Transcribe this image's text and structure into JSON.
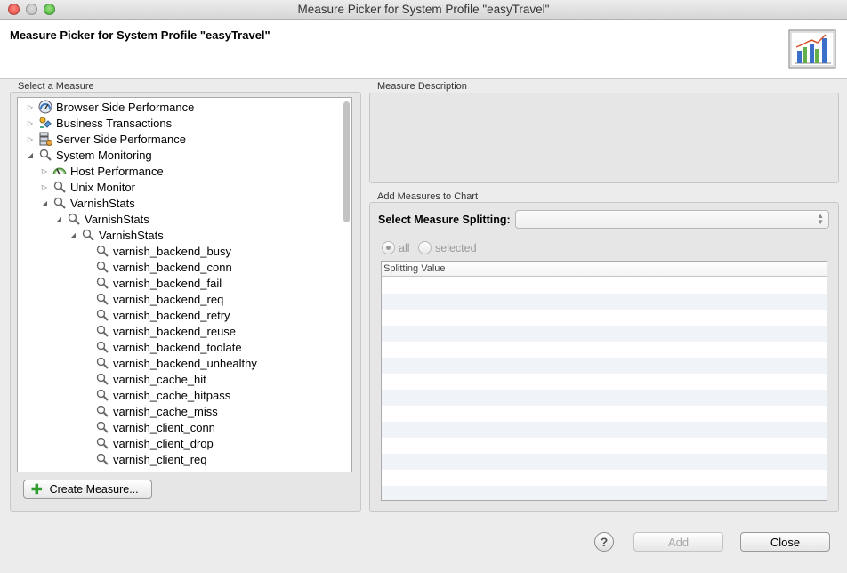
{
  "window": {
    "title": "Measure Picker for System Profile \"easyTravel\""
  },
  "header": {
    "title": "Measure Picker for System Profile \"easyTravel\"",
    "logo_icon": "bar-chart-logo-icon"
  },
  "left_panel": {
    "group_label": "Select a Measure",
    "tree": [
      {
        "label": "Browser Side Performance",
        "level": 0,
        "toggle": "collapsed",
        "icon": "gauge-icon"
      },
      {
        "label": "Business Transactions",
        "level": 0,
        "toggle": "collapsed",
        "icon": "business-transaction-icon"
      },
      {
        "label": "Server Side Performance",
        "level": 0,
        "toggle": "collapsed",
        "icon": "server-icon"
      },
      {
        "label": "System Monitoring",
        "level": 0,
        "toggle": "expanded",
        "icon": "magnifier-icon"
      },
      {
        "label": "Host Performance",
        "level": 1,
        "toggle": "collapsed",
        "icon": "host-gauge-icon"
      },
      {
        "label": "Unix Monitor",
        "level": 1,
        "toggle": "collapsed",
        "icon": "magnifier-icon"
      },
      {
        "label": "VarnishStats",
        "level": 1,
        "toggle": "expanded",
        "icon": "magnifier-icon"
      },
      {
        "label": "VarnishStats",
        "level": 2,
        "toggle": "expanded",
        "icon": "magnifier-icon"
      },
      {
        "label": "VarnishStats",
        "level": 3,
        "toggle": "expanded",
        "icon": "magnifier-icon"
      },
      {
        "label": "varnish_backend_busy",
        "level": 4,
        "toggle": "none",
        "icon": "magnifier-icon"
      },
      {
        "label": "varnish_backend_conn",
        "level": 4,
        "toggle": "none",
        "icon": "magnifier-icon"
      },
      {
        "label": "varnish_backend_fail",
        "level": 4,
        "toggle": "none",
        "icon": "magnifier-icon"
      },
      {
        "label": "varnish_backend_req",
        "level": 4,
        "toggle": "none",
        "icon": "magnifier-icon"
      },
      {
        "label": "varnish_backend_retry",
        "level": 4,
        "toggle": "none",
        "icon": "magnifier-icon"
      },
      {
        "label": "varnish_backend_reuse",
        "level": 4,
        "toggle": "none",
        "icon": "magnifier-icon"
      },
      {
        "label": "varnish_backend_toolate",
        "level": 4,
        "toggle": "none",
        "icon": "magnifier-icon"
      },
      {
        "label": "varnish_backend_unhealthy",
        "level": 4,
        "toggle": "none",
        "icon": "magnifier-icon"
      },
      {
        "label": "varnish_cache_hit",
        "level": 4,
        "toggle": "none",
        "icon": "magnifier-icon"
      },
      {
        "label": "varnish_cache_hitpass",
        "level": 4,
        "toggle": "none",
        "icon": "magnifier-icon"
      },
      {
        "label": "varnish_cache_miss",
        "level": 4,
        "toggle": "none",
        "icon": "magnifier-icon"
      },
      {
        "label": "varnish_client_conn",
        "level": 4,
        "toggle": "none",
        "icon": "magnifier-icon"
      },
      {
        "label": "varnish_client_drop",
        "level": 4,
        "toggle": "none",
        "icon": "magnifier-icon"
      },
      {
        "label": "varnish_client_req",
        "level": 4,
        "toggle": "none",
        "icon": "magnifier-icon"
      }
    ],
    "create_button": "Create Measure..."
  },
  "right_panel": {
    "description_label": "Measure Description",
    "add_label": "Add Measures to Chart",
    "splitting_label": "Select Measure Splitting:",
    "splitting_value": "",
    "radio_all": "all",
    "radio_selected": "selected",
    "table_header": "Splitting Value"
  },
  "footer": {
    "add_button": "Add",
    "close_button": "Close",
    "help_icon": "help-icon"
  },
  "colors": {
    "window_bg": "#ececec",
    "panel_bg": "#e6e6e6",
    "row_stripe": "#f0f4f8",
    "plus_green": "#2f9e2f"
  }
}
